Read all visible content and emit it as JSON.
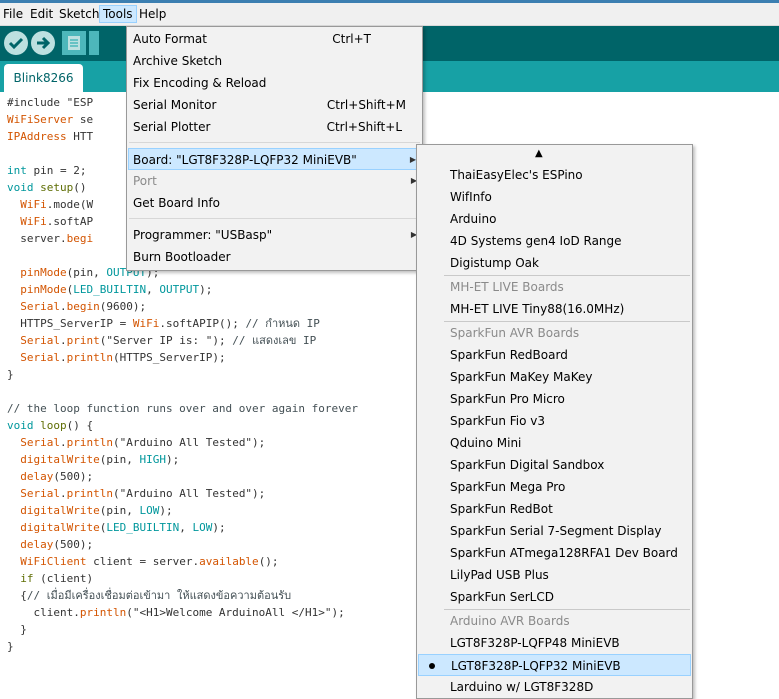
{
  "menubar": {
    "file": "File",
    "edit": "Edit",
    "sketch": "Sketch",
    "tools": "Tools",
    "help": "Help"
  },
  "tab": {
    "name": "Blink8266"
  },
  "code_lines": [
    [
      {
        "t": "#include \"ESP",
        "c": "plain"
      }
    ],
    [
      {
        "t": "WiFiServer",
        "c": "k2"
      },
      {
        "t": " se",
        "c": "plain"
      }
    ],
    [
      {
        "t": "IPAddress",
        "c": "k2"
      },
      {
        "t": " HTT",
        "c": "plain"
      }
    ],
    [],
    [
      {
        "t": "int",
        "c": "k3"
      },
      {
        "t": " pin = 2;",
        "c": "plain"
      }
    ],
    [
      {
        "t": "void",
        "c": "k3"
      },
      {
        "t": " ",
        "c": "plain"
      },
      {
        "t": "setup",
        "c": "k1"
      },
      {
        "t": "()",
        "c": "plain"
      }
    ],
    [
      {
        "t": "  ",
        "c": "plain"
      },
      {
        "t": "WiFi",
        "c": "k2"
      },
      {
        "t": ".mode(W",
        "c": "plain"
      }
    ],
    [
      {
        "t": "  ",
        "c": "plain"
      },
      {
        "t": "WiFi",
        "c": "k2"
      },
      {
        "t": ".softAP",
        "c": "plain"
      }
    ],
    [
      {
        "t": "  server.",
        "c": "plain"
      },
      {
        "t": "begi",
        "c": "k2"
      }
    ],
    [],
    [
      {
        "t": "  ",
        "c": "plain"
      },
      {
        "t": "pinMode",
        "c": "k2"
      },
      {
        "t": "(pin, ",
        "c": "plain"
      },
      {
        "t": "OUTPUT",
        "c": "k3"
      },
      {
        "t": ");",
        "c": "plain"
      }
    ],
    [
      {
        "t": "  ",
        "c": "plain"
      },
      {
        "t": "pinMode",
        "c": "k2"
      },
      {
        "t": "(",
        "c": "plain"
      },
      {
        "t": "LED_BUILTIN",
        "c": "k3"
      },
      {
        "t": ", ",
        "c": "plain"
      },
      {
        "t": "OUTPUT",
        "c": "k3"
      },
      {
        "t": ");",
        "c": "plain"
      }
    ],
    [
      {
        "t": "  ",
        "c": "plain"
      },
      {
        "t": "Serial",
        "c": "k2"
      },
      {
        "t": ".",
        "c": "plain"
      },
      {
        "t": "begin",
        "c": "k2"
      },
      {
        "t": "(9600);",
        "c": "plain"
      }
    ],
    [
      {
        "t": "  HTTPS_ServerIP = ",
        "c": "plain"
      },
      {
        "t": "WiFi",
        "c": "k2"
      },
      {
        "t": ".softAPIP(); ",
        "c": "plain"
      },
      {
        "t": "// กำหนด IP",
        "c": "c"
      }
    ],
    [
      {
        "t": "  ",
        "c": "plain"
      },
      {
        "t": "Serial",
        "c": "k2"
      },
      {
        "t": ".",
        "c": "plain"
      },
      {
        "t": "print",
        "c": "k2"
      },
      {
        "t": "(\"Server IP is: \"); ",
        "c": "plain"
      },
      {
        "t": "// แสดงเลข IP",
        "c": "c"
      }
    ],
    [
      {
        "t": "  ",
        "c": "plain"
      },
      {
        "t": "Serial",
        "c": "k2"
      },
      {
        "t": ".",
        "c": "plain"
      },
      {
        "t": "println",
        "c": "k2"
      },
      {
        "t": "(HTTPS_ServerIP);",
        "c": "plain"
      }
    ],
    [
      {
        "t": "}",
        "c": "plain"
      }
    ],
    [],
    [
      {
        "t": "// the loop function runs over and over again forever",
        "c": "c"
      }
    ],
    [
      {
        "t": "void",
        "c": "k3"
      },
      {
        "t": " ",
        "c": "plain"
      },
      {
        "t": "loop",
        "c": "k1"
      },
      {
        "t": "() {",
        "c": "plain"
      }
    ],
    [
      {
        "t": "  ",
        "c": "plain"
      },
      {
        "t": "Serial",
        "c": "k2"
      },
      {
        "t": ".",
        "c": "plain"
      },
      {
        "t": "println",
        "c": "k2"
      },
      {
        "t": "(\"Arduino All Tested\");",
        "c": "plain"
      }
    ],
    [
      {
        "t": "  ",
        "c": "plain"
      },
      {
        "t": "digitalWrite",
        "c": "k2"
      },
      {
        "t": "(pin, ",
        "c": "plain"
      },
      {
        "t": "HIGH",
        "c": "k3"
      },
      {
        "t": ");",
        "c": "plain"
      }
    ],
    [
      {
        "t": "  ",
        "c": "plain"
      },
      {
        "t": "delay",
        "c": "k2"
      },
      {
        "t": "(500);",
        "c": "plain"
      }
    ],
    [
      {
        "t": "  ",
        "c": "plain"
      },
      {
        "t": "Serial",
        "c": "k2"
      },
      {
        "t": ".",
        "c": "plain"
      },
      {
        "t": "println",
        "c": "k2"
      },
      {
        "t": "(\"Arduino All Tested\");",
        "c": "plain"
      }
    ],
    [
      {
        "t": "  ",
        "c": "plain"
      },
      {
        "t": "digitalWrite",
        "c": "k2"
      },
      {
        "t": "(pin, ",
        "c": "plain"
      },
      {
        "t": "LOW",
        "c": "k3"
      },
      {
        "t": ");",
        "c": "plain"
      }
    ],
    [
      {
        "t": "  ",
        "c": "plain"
      },
      {
        "t": "digitalWrite",
        "c": "k2"
      },
      {
        "t": "(",
        "c": "plain"
      },
      {
        "t": "LED_BUILTIN",
        "c": "k3"
      },
      {
        "t": ", ",
        "c": "plain"
      },
      {
        "t": "LOW",
        "c": "k3"
      },
      {
        "t": ");",
        "c": "plain"
      }
    ],
    [
      {
        "t": "  ",
        "c": "plain"
      },
      {
        "t": "delay",
        "c": "k2"
      },
      {
        "t": "(500);",
        "c": "plain"
      }
    ],
    [
      {
        "t": "  ",
        "c": "plain"
      },
      {
        "t": "WiFiClient",
        "c": "k2"
      },
      {
        "t": " client = server.",
        "c": "plain"
      },
      {
        "t": "available",
        "c": "k2"
      },
      {
        "t": "();",
        "c": "plain"
      }
    ],
    [
      {
        "t": "  ",
        "c": "plain"
      },
      {
        "t": "if",
        "c": "k1"
      },
      {
        "t": " (client)",
        "c": "plain"
      }
    ],
    [
      {
        "t": "  {",
        "c": "plain"
      },
      {
        "t": "// เมื่อมีเครื่องเชื่อมต่อเข้ามา ให้แสดงข้อความต้อนรับ",
        "c": "c"
      }
    ],
    [
      {
        "t": "    client.",
        "c": "plain"
      },
      {
        "t": "println",
        "c": "k2"
      },
      {
        "t": "(\"<H1>Welcome ArduinoAll </H1>\");",
        "c": "plain"
      }
    ],
    [
      {
        "t": "  }",
        "c": "plain"
      }
    ],
    [
      {
        "t": "}",
        "c": "plain"
      }
    ]
  ],
  "tools_menu": {
    "auto_format": {
      "label": "Auto Format",
      "shortcut": "Ctrl+T"
    },
    "archive_sketch": {
      "label": "Archive Sketch"
    },
    "fix_encoding": {
      "label": "Fix Encoding & Reload"
    },
    "serial_monitor": {
      "label": "Serial Monitor",
      "shortcut": "Ctrl+Shift+M"
    },
    "serial_plotter": {
      "label": "Serial Plotter",
      "shortcut": "Ctrl+Shift+L"
    },
    "board": {
      "label": "Board: \"LGT8F328P-LQFP32 MiniEVB\""
    },
    "port": {
      "label": "Port"
    },
    "board_info": {
      "label": "Get Board Info"
    },
    "programmer": {
      "label": "Programmer: \"USBasp\""
    },
    "burn_bootloader": {
      "label": "Burn Bootloader"
    }
  },
  "board_submenu": {
    "scroll_up": "▲",
    "items": [
      {
        "label": "ThaiEasyElec's ESPino",
        "kind": "item"
      },
      {
        "label": "WifInfo",
        "kind": "item"
      },
      {
        "label": "Arduino",
        "kind": "item"
      },
      {
        "label": "4D Systems gen4 IoD Range",
        "kind": "item"
      },
      {
        "label": "Digistump Oak",
        "kind": "item"
      },
      {
        "label": "MH-ET LIVE Boards",
        "kind": "header"
      },
      {
        "label": "MH-ET LIVE Tiny88(16.0MHz)",
        "kind": "item"
      },
      {
        "label": "SparkFun AVR Boards",
        "kind": "header"
      },
      {
        "label": "SparkFun RedBoard",
        "kind": "item"
      },
      {
        "label": "SparkFun MaKey MaKey",
        "kind": "item"
      },
      {
        "label": "SparkFun Pro Micro",
        "kind": "item"
      },
      {
        "label": "SparkFun Fio v3",
        "kind": "item"
      },
      {
        "label": "Qduino Mini",
        "kind": "item"
      },
      {
        "label": "SparkFun Digital Sandbox",
        "kind": "item"
      },
      {
        "label": "SparkFun Mega Pro",
        "kind": "item"
      },
      {
        "label": "SparkFun RedBot",
        "kind": "item"
      },
      {
        "label": "SparkFun Serial 7-Segment Display",
        "kind": "item"
      },
      {
        "label": "SparkFun ATmega128RFA1 Dev Board",
        "kind": "item"
      },
      {
        "label": "LilyPad USB Plus",
        "kind": "item"
      },
      {
        "label": "SparkFun SerLCD",
        "kind": "item"
      },
      {
        "label": "Arduino AVR Boards",
        "kind": "header"
      },
      {
        "label": "LGT8F328P-LQFP48 MiniEVB",
        "kind": "item"
      },
      {
        "label": "LGT8F328P-LQFP32 MiniEVB",
        "kind": "item",
        "selected": true
      },
      {
        "label": "Larduino w/ LGT8F328D",
        "kind": "item"
      }
    ]
  }
}
